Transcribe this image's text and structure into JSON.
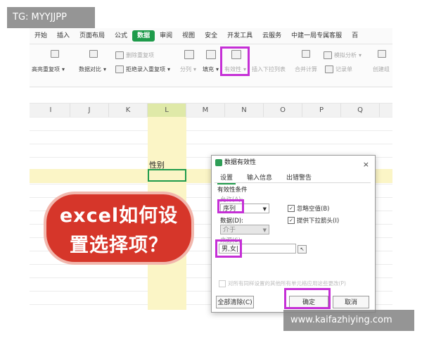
{
  "watermarks": {
    "top_left": "TG: MYYJJPP",
    "bottom_right": "www.kaifazhiying.com"
  },
  "ribbon": {
    "tabs": [
      "开始",
      "插入",
      "页面布局",
      "公式",
      "数据",
      "审阅",
      "视图",
      "安全",
      "开发工具",
      "云服务",
      "中建一局专属客服",
      "百"
    ],
    "active_tab": "数据",
    "tools": {
      "highlight_dup": "高亮重复项",
      "delete_dup": "删除重复项",
      "data_compare": "数据对比",
      "reject_dup": "拒绝录入重复项",
      "split": "分列",
      "fill": "填充",
      "validity": "有效性",
      "insert_dropdown": "插入下拉列表",
      "merge_calc": "合并计算",
      "record_sheet": "记录单",
      "simulate": "模拟分析",
      "create_group": "创建组"
    }
  },
  "sheet": {
    "columns": [
      "I",
      "J",
      "K",
      "L",
      "M",
      "N",
      "O",
      "P",
      "Q"
    ],
    "selected_column": "L",
    "header_cell": "性别"
  },
  "overlay_title": {
    "line1": "excel如何设",
    "line2": "置选择项？"
  },
  "dialog": {
    "title": "数据有效性",
    "close": "×",
    "tabs": [
      "设置",
      "输入信息",
      "出错警告"
    ],
    "active_tab": "设置",
    "section": "有效性条件",
    "allow_label": "允许(A):",
    "allow_value": "序列",
    "data_label": "数据(D):",
    "data_value": "介于",
    "ignore_blank": "忽略空值(B)",
    "ignore_blank_checked": true,
    "dropdown_arrow": "提供下拉箭头(I)",
    "dropdown_arrow_checked": true,
    "source_label": "来源(S):",
    "source_value": "男,女|",
    "apply_all": "对所有同样设置的其他所有单元格应用这些更改(P)",
    "clear_all": "全部清除(C)",
    "ok": "确定",
    "cancel": "取消"
  },
  "colors": {
    "accent": "#1e9b4b",
    "highlight": "#c52fd6",
    "bubble": "#d6362a",
    "column_highlight": "#fbf5c6"
  }
}
